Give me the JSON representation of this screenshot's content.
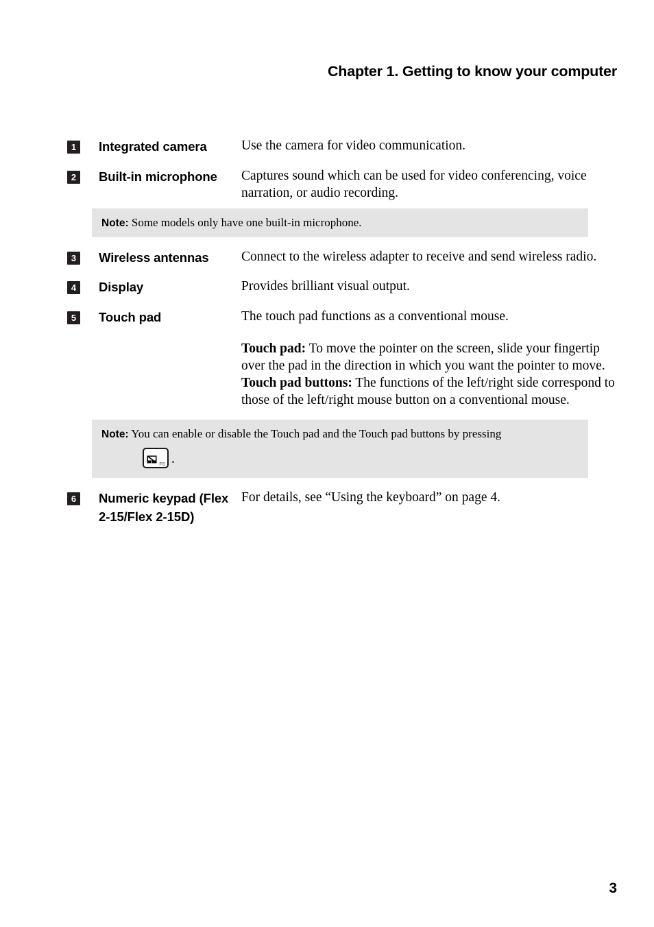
{
  "header": {
    "title": "Chapter 1. Getting to know your computer"
  },
  "features": [
    {
      "number": "1",
      "label": "Integrated camera",
      "description": "Use the camera for video communication."
    },
    {
      "number": "2",
      "label": "Built-in microphone",
      "description": "Captures sound which can be used for video conferencing, voice narration, or audio recording."
    },
    {
      "number": "3",
      "label": "Wireless antennas",
      "description": "Connect to the wireless adapter to receive and send wireless radio."
    },
    {
      "number": "4",
      "label": "Display",
      "description": "Provides brilliant visual output."
    },
    {
      "number": "5",
      "label": "Touch pad",
      "description": "The touch pad functions as a conventional mouse.",
      "detail_paragraphs": [
        {
          "lead": "Touch pad:",
          "text": " To move the pointer on the screen, slide your fingertip over the pad in the direction in which you want the pointer to move."
        },
        {
          "lead": "Touch pad buttons:",
          "text": " The functions of the left/right side correspond to those of the left/right mouse button on a conventional mouse."
        }
      ]
    },
    {
      "number": "6",
      "label": "Numeric keypad (Flex 2-15/Flex 2-15D)",
      "description": "For details, see “Using the keyboard” on page 4."
    }
  ],
  "notes": [
    {
      "label": "Note:",
      "text": " Some models only have one built-in microphone."
    },
    {
      "label": "Note:",
      "text": " You can enable or disable the Touch pad and the Touch pad buttons by pressing",
      "key": {
        "icon": "touchpad-disabled-icon",
        "fn_label": "F6"
      },
      "trailing_punctuation": "."
    }
  ],
  "footer": {
    "page_number": "3"
  },
  "colors": {
    "note_background": "#e4e4e4",
    "badge_background": "#231f20",
    "text": "#000000"
  }
}
